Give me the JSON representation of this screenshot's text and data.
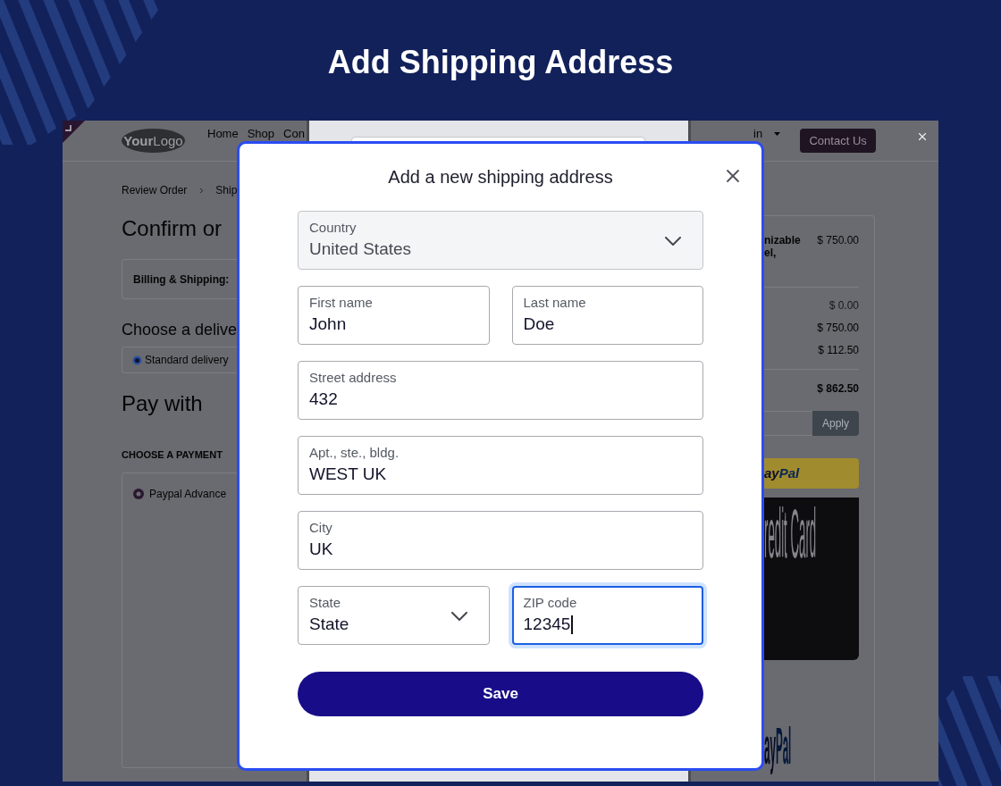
{
  "page": {
    "title": "Add Shipping Address"
  },
  "store_page": {
    "header": {
      "logo": "**Your**Logo",
      "nav": [
        "Home",
        "Shop",
        "Con"
      ],
      "user_menu": "in",
      "contact_button": "Contact Us"
    },
    "breadcrumb": [
      "Review Order",
      "Ship"
    ],
    "heading": "Confirm or",
    "billing_label": "Billing & Shipping:",
    "delivery_heading": "Choose a delive",
    "delivery_options": [
      {
        "label": "Standard delivery",
        "selected": true
      }
    ],
    "pay_heading": "Pay with",
    "payment_heading": "CHOOSE A PAYMENT",
    "payment_options": [
      {
        "label": "Paypal Advance",
        "selected": true
      }
    ],
    "summary": {
      "product_name": [
        "nizable",
        "el,"
      ],
      "product_price": "$ 750.00",
      "amounts": [
        {
          "text": "$ 0.00",
          "muted": true
        },
        {
          "text": "$ 750.00",
          "muted": false
        },
        {
          "text": "$ 112.50",
          "muted": false
        }
      ],
      "total": "$ 862.50",
      "coupon_button": "Apply",
      "paypal_button": [
        "ay",
        "Pal"
      ],
      "card_button": "redit Card",
      "paypal_logo": [
        "ay",
        "Pal"
      ]
    }
  },
  "dialog": {
    "title": "Add a new shipping address",
    "rows": [
      [
        {
          "kind": "select",
          "label": "Country",
          "value": "United States",
          "disabled": true,
          "focused": false
        }
      ],
      [
        {
          "kind": "text",
          "label": "First name",
          "value": "John",
          "disabled": false,
          "focused": false
        },
        {
          "kind": "text",
          "label": "Last name",
          "value": "Doe",
          "disabled": false,
          "focused": false
        }
      ],
      [
        {
          "kind": "text",
          "label": "Street address",
          "value": "432",
          "disabled": false,
          "focused": false
        }
      ],
      [
        {
          "kind": "text",
          "label": "Apt., ste., bldg.",
          "value": "WEST UK",
          "disabled": false,
          "focused": false
        }
      ],
      [
        {
          "kind": "text",
          "label": "City",
          "value": "UK",
          "disabled": false,
          "focused": false
        }
      ],
      [
        {
          "kind": "select",
          "label": "State",
          "value": "State",
          "disabled": false,
          "focused": false
        },
        {
          "kind": "text",
          "label": "ZIP code",
          "value": "12345",
          "disabled": false,
          "focused": true
        }
      ]
    ],
    "save_button": "Save"
  }
}
